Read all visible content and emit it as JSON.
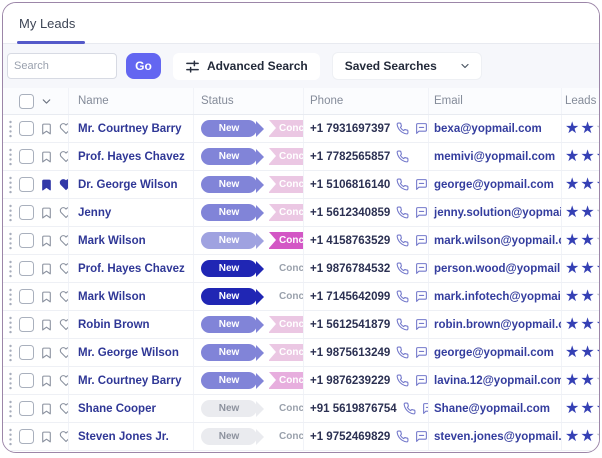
{
  "tab": {
    "my_leads": "My Leads"
  },
  "toolbar": {
    "search_placeholder": "Search",
    "go_label": "Go",
    "advanced_search_label": "Advanced Search",
    "saved_searches_label": "Saved Searches"
  },
  "colors": {
    "accent_indigo": "#6366f1",
    "tab_underline": "#5459c9",
    "name_text": "#2f3796",
    "email_text": "#343d9e",
    "star_filled": "#3540b4",
    "status_new_purple": "#8184d8",
    "status_new_purple_light": "#9fa2e0",
    "status_new_navy": "#2026b4",
    "status_new_gray": "#eaebef",
    "status_next_pink": "#ebc7e3",
    "status_next_pink_mid": "#e7aede",
    "status_next_pink_bright": "#d357c5",
    "icon_filled": "#3239a8",
    "card_border": "#9c86a8"
  },
  "table": {
    "headers": {
      "name": "Name",
      "status": "Status",
      "phone": "Phone",
      "email": "Email",
      "score": "Leads Score"
    },
    "stars_visible": 3,
    "rows": [
      {
        "name": "Mr. Courtney Barry",
        "status": {
          "new": "New",
          "next": "Concepts",
          "new_style": "purple",
          "next_style": "pink"
        },
        "phone": "+1 7931697397",
        "email": "bexa@yopmail.com",
        "bookmarked": false,
        "favorited": false,
        "has_sms": true,
        "score": 2
      },
      {
        "name": "Prof. Hayes Chavez",
        "status": {
          "new": "New",
          "next": "Concepts",
          "new_style": "purple",
          "next_style": "pink"
        },
        "phone": "+1 7782565857",
        "email": "memivi@yopmail.com",
        "bookmarked": false,
        "favorited": false,
        "has_sms": false,
        "score": 3
      },
      {
        "name": "Dr. George Wilson",
        "status": {
          "new": "New",
          "next": "Concepts",
          "new_style": "purple",
          "next_style": "pink"
        },
        "phone": "+1 5106816140",
        "email": "george@yopmail.com",
        "bookmarked": true,
        "favorited": true,
        "has_sms": true,
        "score": 3
      },
      {
        "name": "Jenny",
        "status": {
          "new": "New",
          "next": "Concepts",
          "new_style": "purple",
          "next_style": "pink"
        },
        "phone": "+1 5612340859",
        "email": "jenny.solution@yopmail.com",
        "bookmarked": false,
        "favorited": false,
        "has_sms": true,
        "score": 2
      },
      {
        "name": "Mark Wilson",
        "status": {
          "new": "New",
          "next": "Concepts",
          "new_style": "purple-light",
          "next_style": "pink-bright"
        },
        "phone": "+1 4158763529",
        "email": "mark.wilson@yopmail.com",
        "bookmarked": false,
        "favorited": false,
        "has_sms": true,
        "score": 2
      },
      {
        "name": "Prof. Hayes Chavez",
        "status": {
          "new": "New",
          "next": "Concepts",
          "new_style": "navy",
          "next_style": "plain"
        },
        "phone": "+1 9876784532",
        "email": "person.wood@yopmail.com",
        "bookmarked": false,
        "favorited": false,
        "has_sms": true,
        "score": 3
      },
      {
        "name": "Mark Wilson",
        "status": {
          "new": "New",
          "next": "Concepts",
          "new_style": "navy",
          "next_style": "plain"
        },
        "phone": "+1 7145642099",
        "email": "mark.infotech@yopmail.com",
        "bookmarked": false,
        "favorited": false,
        "has_sms": true,
        "score": 2
      },
      {
        "name": "Robin Brown",
        "status": {
          "new": "New",
          "next": "Concepts",
          "new_style": "purple",
          "next_style": "pink"
        },
        "phone": "+1 5612541879",
        "email": "robin.brown@yopmail.com",
        "bookmarked": false,
        "favorited": false,
        "has_sms": true,
        "score": 3
      },
      {
        "name": "Mr. George Wilson",
        "status": {
          "new": "New",
          "next": "Concepts",
          "new_style": "purple",
          "next_style": "pink"
        },
        "phone": "+1 9875613249",
        "email": "george@yopmail.com",
        "bookmarked": false,
        "favorited": false,
        "has_sms": true,
        "score": 3
      },
      {
        "name": "Mr. Courtney Barry",
        "status": {
          "new": "New",
          "next": "Concepts",
          "new_style": "purple",
          "next_style": "pink-mid"
        },
        "phone": "+1 9876239229",
        "email": "lavina.12@yopmail.com",
        "bookmarked": false,
        "favorited": false,
        "has_sms": true,
        "score": 2
      },
      {
        "name": "Shane Cooper",
        "status": {
          "new": "New",
          "next": "Concepts",
          "new_style": "gray",
          "next_style": "plain"
        },
        "phone": "+91 5619876754",
        "email": "Shane@yopmail.com",
        "bookmarked": false,
        "favorited": false,
        "has_sms": true,
        "score": 3
      },
      {
        "name": "Steven Jones Jr.",
        "status": {
          "new": "New",
          "next": "Concepts",
          "new_style": "gray",
          "next_style": "plain"
        },
        "phone": "+1 9752469829",
        "email": "steven.jones@yopmail.com",
        "bookmarked": false,
        "favorited": false,
        "has_sms": true,
        "score": 2
      }
    ]
  }
}
